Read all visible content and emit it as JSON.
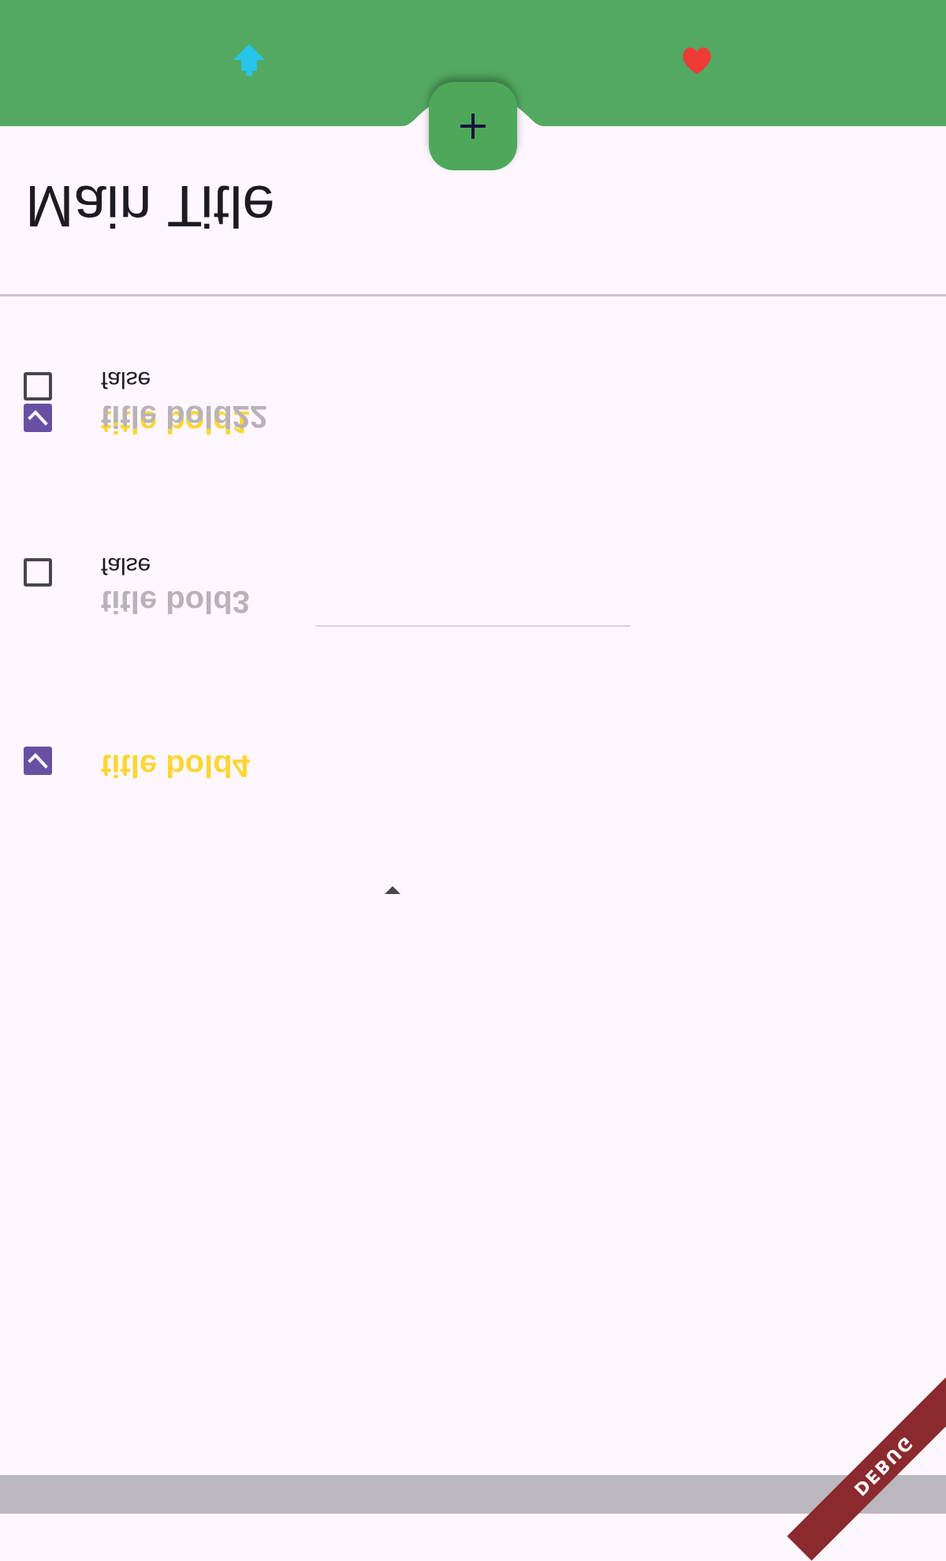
{
  "app": {
    "main_title": "Main Title",
    "debug_label": "DEBUG"
  },
  "colors": {
    "bar_green": "#53a962",
    "fab_green": "#4ea85a",
    "checked_purple": "#6750a4",
    "title_checked_yellow": "#fbd635",
    "title_unchecked_grey": "#b8b3b8"
  },
  "list": {
    "items": [
      {
        "title": "title bold1",
        "checked": true,
        "subtitle": ""
      },
      {
        "title": "title bold22",
        "checked": false,
        "subtitle": "false"
      },
      {
        "title": "title bold3",
        "checked": false,
        "subtitle": "false"
      },
      {
        "title": "title bold4",
        "checked": true,
        "subtitle": ""
      }
    ]
  },
  "bottom_bar": {
    "left_icon": "upload-arrow-icon",
    "right_icon": "heart-icon",
    "fab_icon": "add-icon"
  }
}
